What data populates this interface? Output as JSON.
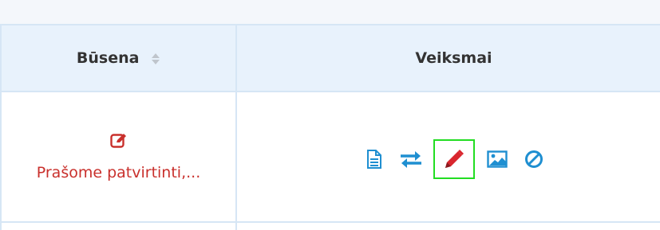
{
  "table": {
    "columns": {
      "status": "Būsena",
      "actions": "Veiksmai"
    },
    "rows": [
      {
        "status_icon": "edit-square-icon",
        "status_text": "Prašome patvirtinti,...",
        "actions": [
          {
            "icon": "document-icon",
            "label": "document"
          },
          {
            "icon": "transfer-arrows-icon",
            "label": "transfer"
          },
          {
            "icon": "pencil-icon",
            "label": "edit"
          },
          {
            "icon": "image-icon",
            "label": "image"
          },
          {
            "icon": "ban-icon",
            "label": "cancel"
          }
        ]
      }
    ]
  },
  "colors": {
    "header_bg": "#e8f2fc",
    "border": "#d6e6f5",
    "status_red": "#c9302c",
    "action_blue": "#1f8fd1",
    "highlight_green": "#22dd22"
  }
}
